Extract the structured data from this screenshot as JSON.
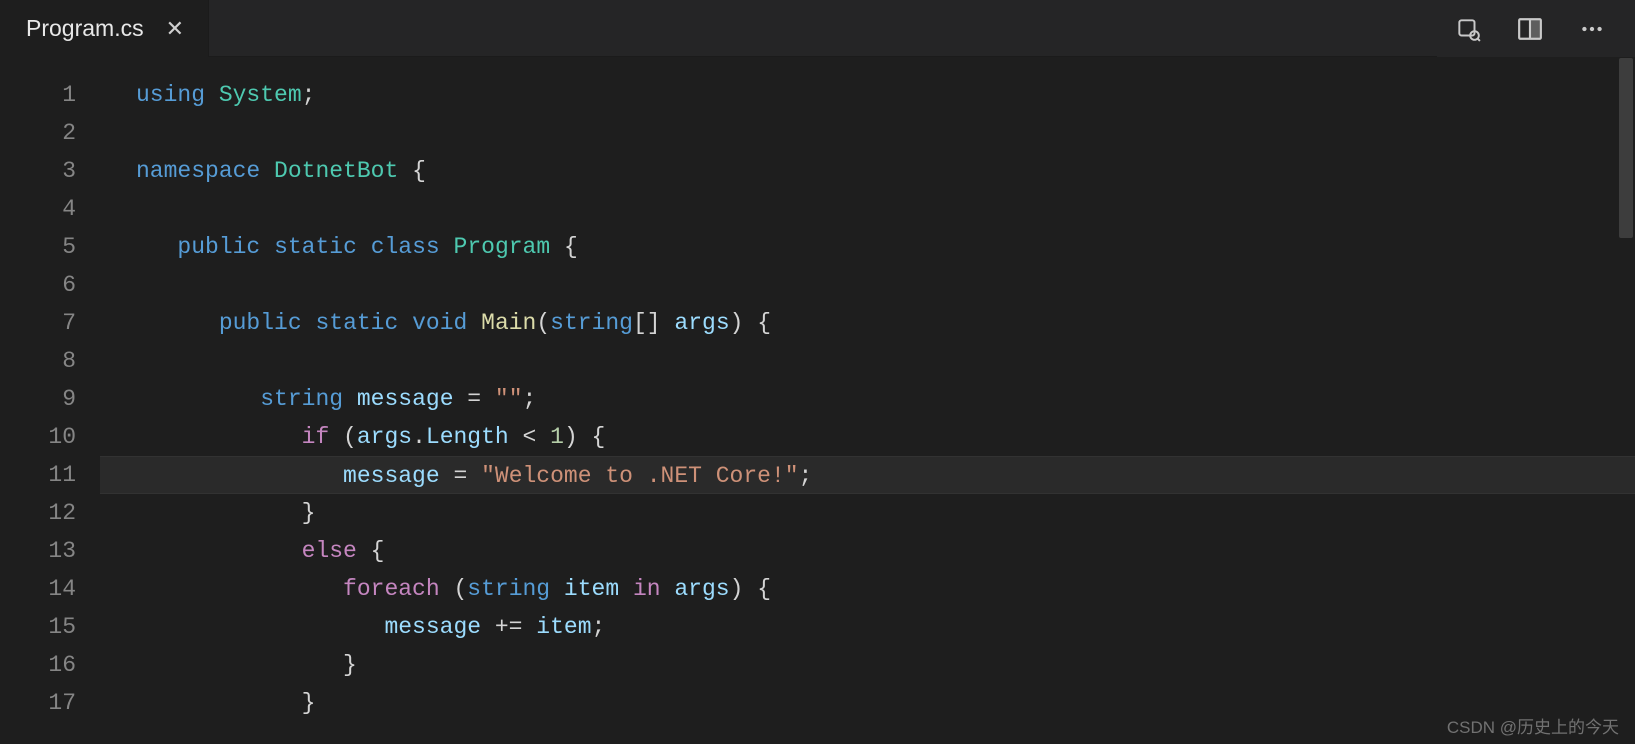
{
  "tab": {
    "filename": "Program.cs"
  },
  "syntax": {
    "colors": {
      "keyword_blue": "#569cd6",
      "keyword_purple": "#c586c0",
      "type": "#4ec9b0",
      "method": "#dcdcaa",
      "variable": "#9cdcfe",
      "string": "#ce9178",
      "number": "#b5cea8",
      "punct": "#d4d4d4"
    }
  },
  "code": {
    "lines": [
      {
        "n": 1,
        "indent": 0,
        "tokens": [
          [
            "keyword_blue",
            "using"
          ],
          [
            "punct",
            " "
          ],
          [
            "type",
            "System"
          ],
          [
            "punct",
            ";"
          ]
        ]
      },
      {
        "n": 2,
        "indent": 0,
        "tokens": []
      },
      {
        "n": 3,
        "indent": 0,
        "tokens": [
          [
            "keyword_blue",
            "namespace"
          ],
          [
            "punct",
            " "
          ],
          [
            "type",
            "DotnetBot"
          ],
          [
            "punct",
            " {"
          ]
        ]
      },
      {
        "n": 4,
        "indent": 0,
        "tokens": []
      },
      {
        "n": 5,
        "indent": 1,
        "tokens": [
          [
            "keyword_blue",
            "public"
          ],
          [
            "punct",
            " "
          ],
          [
            "keyword_blue",
            "static"
          ],
          [
            "punct",
            " "
          ],
          [
            "keyword_blue",
            "class"
          ],
          [
            "punct",
            " "
          ],
          [
            "type",
            "Program"
          ],
          [
            "punct",
            " {"
          ]
        ]
      },
      {
        "n": 6,
        "indent": 0,
        "tokens": []
      },
      {
        "n": 7,
        "indent": 2,
        "tokens": [
          [
            "keyword_blue",
            "public"
          ],
          [
            "punct",
            " "
          ],
          [
            "keyword_blue",
            "static"
          ],
          [
            "punct",
            " "
          ],
          [
            "keyword_blue",
            "void"
          ],
          [
            "punct",
            " "
          ],
          [
            "method",
            "Main"
          ],
          [
            "punct",
            "("
          ],
          [
            "keyword_blue",
            "string"
          ],
          [
            "punct",
            "[] "
          ],
          [
            "variable",
            "args"
          ],
          [
            "punct",
            ") {"
          ]
        ]
      },
      {
        "n": 8,
        "indent": 0,
        "tokens": []
      },
      {
        "n": 9,
        "indent": 3,
        "tokens": [
          [
            "keyword_blue",
            "string"
          ],
          [
            "punct",
            " "
          ],
          [
            "variable",
            "message"
          ],
          [
            "punct",
            " = "
          ],
          [
            "string",
            "\"\""
          ],
          [
            "punct",
            ";"
          ]
        ]
      },
      {
        "n": 10,
        "indent": 4,
        "tokens": [
          [
            "keyword_purple",
            "if"
          ],
          [
            "punct",
            " ("
          ],
          [
            "variable",
            "args"
          ],
          [
            "punct",
            "."
          ],
          [
            "variable",
            "Length"
          ],
          [
            "punct",
            " < "
          ],
          [
            "number",
            "1"
          ],
          [
            "punct",
            ") {"
          ]
        ]
      },
      {
        "n": 11,
        "indent": 5,
        "current": true,
        "tokens": [
          [
            "variable",
            "message"
          ],
          [
            "punct",
            " = "
          ],
          [
            "string",
            "\"Welcome to .NET Core!\""
          ],
          [
            "punct",
            ";"
          ]
        ]
      },
      {
        "n": 12,
        "indent": 4,
        "tokens": [
          [
            "punct",
            "}"
          ]
        ]
      },
      {
        "n": 13,
        "indent": 4,
        "tokens": [
          [
            "keyword_purple",
            "else"
          ],
          [
            "punct",
            " {"
          ]
        ]
      },
      {
        "n": 14,
        "indent": 5,
        "tokens": [
          [
            "keyword_purple",
            "foreach"
          ],
          [
            "punct",
            " ("
          ],
          [
            "keyword_blue",
            "string"
          ],
          [
            "punct",
            " "
          ],
          [
            "variable",
            "item"
          ],
          [
            "punct",
            " "
          ],
          [
            "keyword_purple",
            "in"
          ],
          [
            "punct",
            " "
          ],
          [
            "variable",
            "args"
          ],
          [
            "punct",
            ") {"
          ]
        ]
      },
      {
        "n": 15,
        "indent": 6,
        "tokens": [
          [
            "variable",
            "message"
          ],
          [
            "punct",
            " += "
          ],
          [
            "variable",
            "item"
          ],
          [
            "punct",
            ";"
          ]
        ]
      },
      {
        "n": 16,
        "indent": 5,
        "tokens": [
          [
            "punct",
            "}"
          ]
        ]
      },
      {
        "n": 17,
        "indent": 4,
        "tokens": [
          [
            "punct",
            "}"
          ]
        ]
      }
    ]
  },
  "watermark": "CSDN @历史上的今天"
}
